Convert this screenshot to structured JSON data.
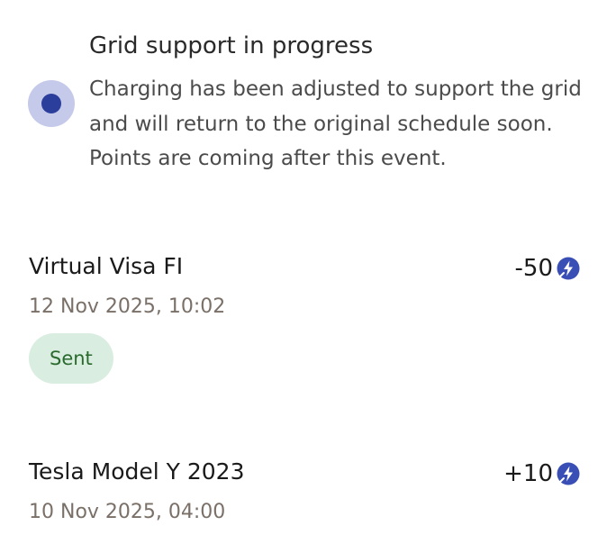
{
  "banner": {
    "title": "Grid support in progress",
    "description": "Charging has been adjusted to support the grid and will return to the original schedule soon. Points are coming after this event."
  },
  "activities": [
    {
      "title": "Virtual Visa FI",
      "date": "12 Nov 2025, 10:02",
      "points": "-50",
      "status": "Sent"
    },
    {
      "title": "Tesla Model Y 2023",
      "date": "10 Nov 2025, 04:00",
      "points": "+10"
    }
  ],
  "icons": {
    "status_dot": "status-dot-icon",
    "points_badge": "lightning-bolt-icon"
  },
  "colors": {
    "accent": "#2b3e9c",
    "accent_light": "#c5c9ea",
    "chip_bg": "#d9ede0",
    "chip_text": "#2a6a2e",
    "date_text": "#7a7068"
  }
}
